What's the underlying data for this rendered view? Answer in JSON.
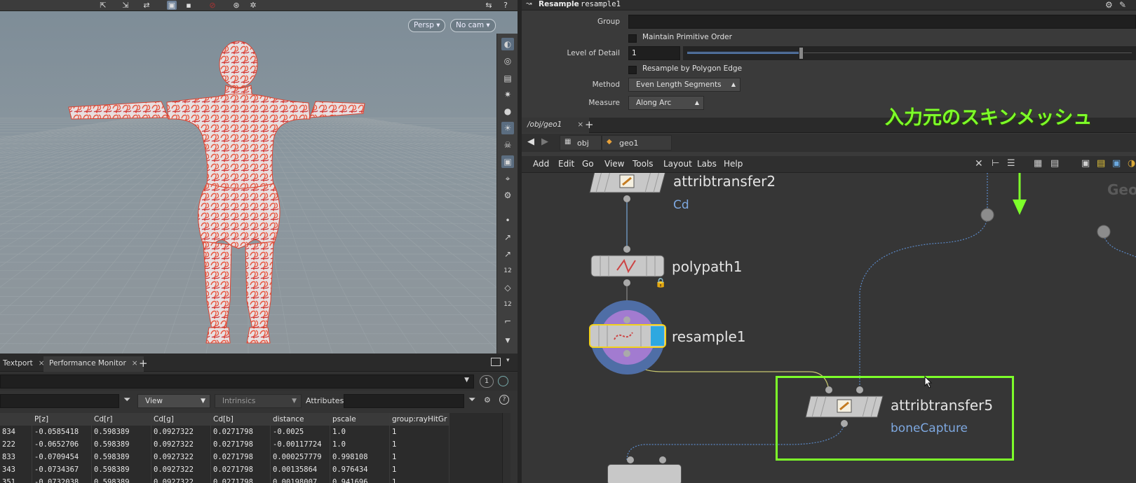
{
  "viewport": {
    "persp_label": "Persp",
    "cam_label": "No cam"
  },
  "bottom_left": {
    "tabs": [
      {
        "label": "Textport"
      },
      {
        "label": "Performance Monitor"
      }
    ],
    "add_tab_symbol": "+",
    "close_symbol": "×",
    "view_dropdown": "View",
    "intrinsics_dropdown": "Intrinsics",
    "attributes_label": "Attributes:",
    "page_number": "1",
    "spreadsheet": {
      "columns": [
        "",
        "P[z]",
        "Cd[r]",
        "Cd[g]",
        "Cd[b]",
        "distance",
        "pscale",
        "group:rayHitGr"
      ],
      "rows": [
        [
          "834",
          "-0.0585418",
          "0.598389",
          "0.0927322",
          "0.0271798",
          "-0.0025",
          "1.0",
          "1"
        ],
        [
          "222",
          "-0.0652706",
          "0.598389",
          "0.0927322",
          "0.0271798",
          "-0.00117724",
          "1.0",
          "1"
        ],
        [
          "833",
          "-0.0709454",
          "0.598389",
          "0.0927322",
          "0.0271798",
          "0.000257779",
          "0.998108",
          "1"
        ],
        [
          "343",
          "-0.0734367",
          "0.598389",
          "0.0927322",
          "0.0271798",
          "0.00135864",
          "0.976434",
          "1"
        ],
        [
          "351",
          "-0.0732038",
          "0.598389",
          "0.0927322",
          "0.0271798",
          "0.00198007",
          "0.941696",
          "1"
        ]
      ]
    }
  },
  "params": {
    "node_type": "Resample",
    "node_name": "resample1",
    "group_label": "Group",
    "maintain_order_label": "Maintain Primitive Order",
    "lod_label": "Level of Detail",
    "lod_value": "1",
    "lod_slider_fraction": 0.25,
    "resample_by_edge_label": "Resample by Polygon Edge",
    "method_label": "Method",
    "method_value": "Even Length Segments",
    "measure_label": "Measure",
    "measure_value": "Along Arc"
  },
  "network": {
    "tab_label": "/obj/geo1",
    "tab_close": "×",
    "add_tab": "+",
    "path": [
      "obj",
      "geo1"
    ],
    "menu": [
      "Add",
      "Edit",
      "Go",
      "View",
      "Tools",
      "Layout",
      "Labs",
      "Help"
    ],
    "nodes": {
      "attribtransfer2": {
        "name": "attribtransfer2",
        "sub": "Cd"
      },
      "polypath1": {
        "name": "polypath1"
      },
      "resample1": {
        "name": "resample1"
      },
      "attribtransfer5": {
        "name": "attribtransfer5",
        "sub": "boneCapture"
      }
    },
    "partial_node_label": "Geo"
  },
  "annotation": {
    "text": "入力元のスキンメッシュ",
    "color": "#7dff2a"
  }
}
